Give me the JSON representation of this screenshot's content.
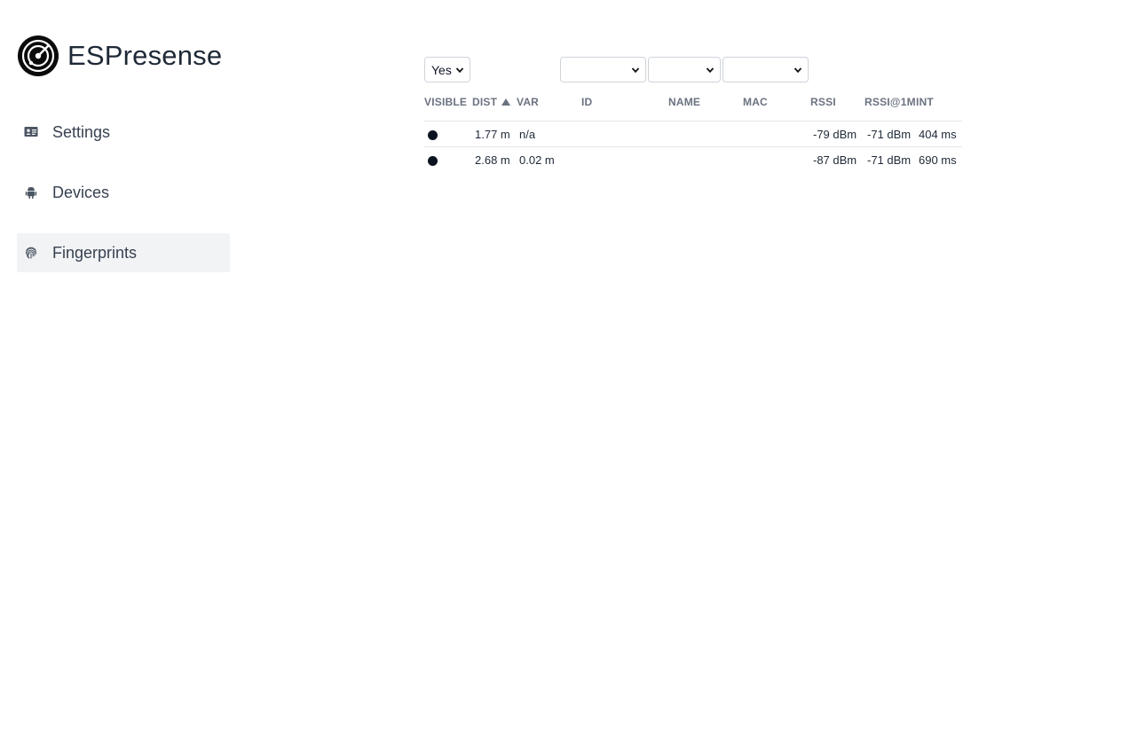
{
  "brand": {
    "name": "ESPresense"
  },
  "sidebar": {
    "items": [
      {
        "label": "Settings",
        "icon": "id-card-icon",
        "active": false
      },
      {
        "label": "Devices",
        "icon": "android-icon",
        "active": false
      },
      {
        "label": "Fingerprints",
        "icon": "fingerprint-icon",
        "active": true
      }
    ]
  },
  "filters": {
    "visible": {
      "selected": "Yes"
    },
    "id": {
      "selected": ""
    },
    "name": {
      "selected": ""
    },
    "mac": {
      "selected": ""
    }
  },
  "table": {
    "columns": [
      "VISIBLE",
      "DIST",
      "VAR",
      "ID",
      "NAME",
      "MAC",
      "RSSI",
      "RSSI@1M",
      "INT"
    ],
    "sort": {
      "column": "DIST",
      "direction": "ascending"
    },
    "rows": [
      {
        "visible": true,
        "dist": "1.77 m",
        "var": "n/a",
        "id": "",
        "name": "",
        "mac": "",
        "rssi": "-79 dBm",
        "rssi1m": "-71 dBm",
        "int": "404 ms"
      },
      {
        "visible": true,
        "dist": "2.68 m",
        "var": "0.02 m",
        "id": "",
        "name": "",
        "mac": "",
        "rssi": "-87 dBm",
        "rssi1m": "-71 dBm",
        "int": "690 ms"
      }
    ]
  },
  "colors": {
    "active_nav_bg": "#f2f3f5",
    "text": "#1f2937",
    "header_text": "#6b7280",
    "dot": "#0b1220"
  }
}
